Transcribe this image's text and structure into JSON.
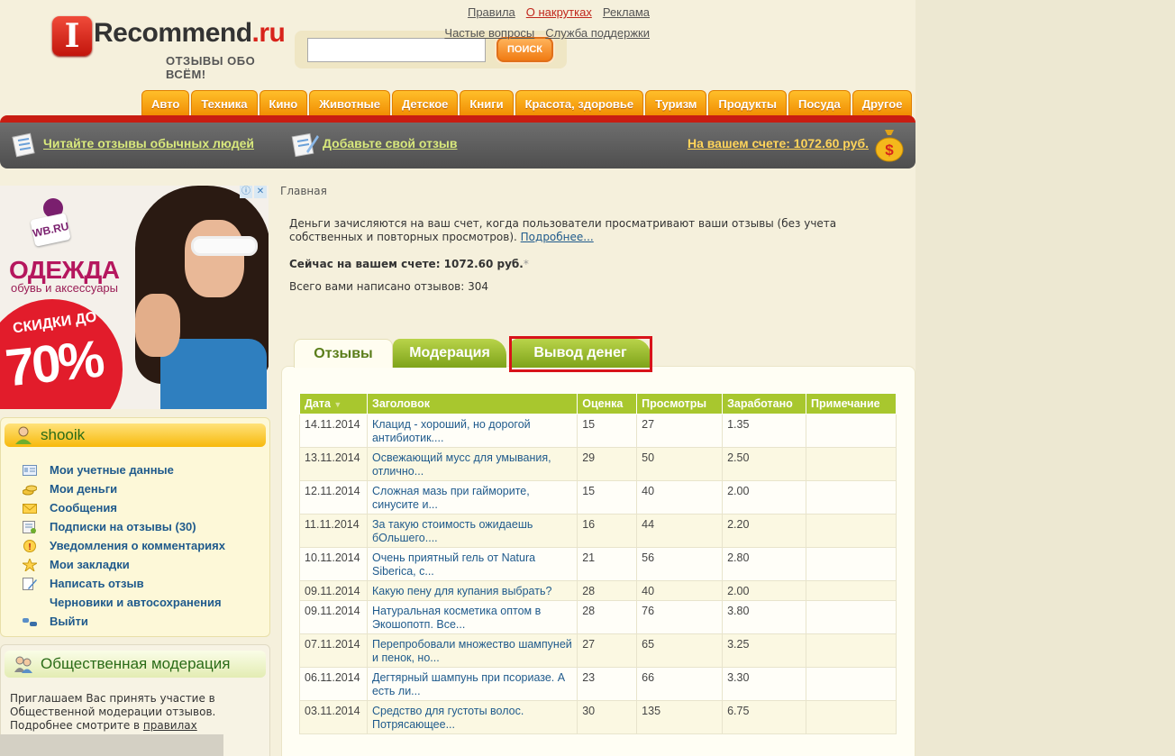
{
  "header": {
    "logo_i": "I",
    "logo_main": "Recommend",
    "logo_ru": ".ru",
    "slogan": "ОТЗЫВЫ ОБО ВСЁМ!",
    "search_placeholder": "",
    "search_button": "ПОИСК",
    "toplinks_row1": [
      "Правила",
      "О накрутках",
      "Реклама"
    ],
    "toplinks_row2": [
      "Частые вопросы",
      "Служба поддержки"
    ]
  },
  "categories": [
    "Авто",
    "Техника",
    "Кино",
    "Животные",
    "Детское",
    "Книги",
    "Красота, здоровье",
    "Туризм",
    "Продукты",
    "Посуда",
    "Другое"
  ],
  "darkbar": {
    "read": "Читайте отзывы обычных людей",
    "add": "Добавьте свой отзыв",
    "account": "На вашем счете: 1072.60 руб."
  },
  "ad": {
    "brand": "WB.RU",
    "headline": "ОДЕЖДА",
    "sub": "обувь и аксессуары",
    "disc1": "СКИДКИ ДО",
    "disc2": "70%"
  },
  "user": {
    "name": "shooik",
    "menu": [
      {
        "label": "Мои учетные данные",
        "icon": "id-card-icon"
      },
      {
        "label": "Мои деньги",
        "icon": "coins-icon"
      },
      {
        "label": "Сообщения",
        "icon": "envelope-icon"
      },
      {
        "label": "Подписки на отзывы (30)",
        "icon": "subscription-icon"
      },
      {
        "label": "Уведомления о комментариях",
        "icon": "alert-icon"
      },
      {
        "label": "Мои закладки",
        "icon": "star-icon"
      },
      {
        "label": "Написать отзыв",
        "icon": "pencil-icon"
      },
      {
        "label": "Черновики и автосохранения",
        "icon": ""
      },
      {
        "label": "Выйти",
        "icon": "exit-icon"
      }
    ]
  },
  "moderation": {
    "title": "Общественная модерация",
    "text": "Приглашаем Вас принять участие в Общественной модерации отзывов. Подробнее смотрите в ",
    "link": "правилах"
  },
  "main": {
    "breadcrumb": "Главная",
    "info": "Деньги зачисляются на ваш счет, когда пользователи просматривают ваши отзывы (без учета собственных и повторных просмотров). ",
    "info_link": "Подробнее...",
    "balance": "Сейчас на вашем счете: 1072.60 руб.",
    "balance_star": "*",
    "total": "Всего вами написано отзывов: 304",
    "tabs": [
      "Отзывы",
      "Модерация",
      "Вывод денег"
    ]
  },
  "table": {
    "headers": [
      "Дата",
      "Заголовок",
      "Оценка",
      "Просмотры",
      "Заработано",
      "Примечание"
    ],
    "rows": [
      {
        "date": "14.11.2014",
        "title": "Клацид - хороший, но дорогой антибиотик....",
        "score": "15",
        "views": "27",
        "earned": "1.35",
        "note": ""
      },
      {
        "date": "13.11.2014",
        "title": "Освежающий мусс для умывания, отлично...",
        "score": "29",
        "views": "50",
        "earned": "2.50",
        "note": ""
      },
      {
        "date": "12.11.2014",
        "title": "Сложная мазь при гайморите, синусите и...",
        "score": "15",
        "views": "40",
        "earned": "2.00",
        "note": ""
      },
      {
        "date": "11.11.2014",
        "title": "За такую стоимость ожидаешь бОльшего....",
        "score": "16",
        "views": "44",
        "earned": "2.20",
        "note": ""
      },
      {
        "date": "10.11.2014",
        "title": "Очень приятный гель от Natura Siberica, с...",
        "score": "21",
        "views": "56",
        "earned": "2.80",
        "note": ""
      },
      {
        "date": "09.11.2014",
        "title": "Какую пену для купания выбрать?",
        "score": "28",
        "views": "40",
        "earned": "2.00",
        "note": ""
      },
      {
        "date": "09.11.2014",
        "title": "Натуральная косметика оптом в Экошопотп. Все...",
        "score": "28",
        "views": "76",
        "earned": "3.80",
        "note": ""
      },
      {
        "date": "07.11.2014",
        "title": "Перепробовали множество шампуней и пенок, но...",
        "score": "27",
        "views": "65",
        "earned": "3.25",
        "note": ""
      },
      {
        "date": "06.11.2014",
        "title": "Дегтярный шампунь при псориазе. А есть ли...",
        "score": "23",
        "views": "66",
        "earned": "3.30",
        "note": ""
      },
      {
        "date": "03.11.2014",
        "title": "Средство для густоты волос. Потрясающее...",
        "score": "30",
        "views": "135",
        "earned": "6.75",
        "note": ""
      }
    ]
  }
}
